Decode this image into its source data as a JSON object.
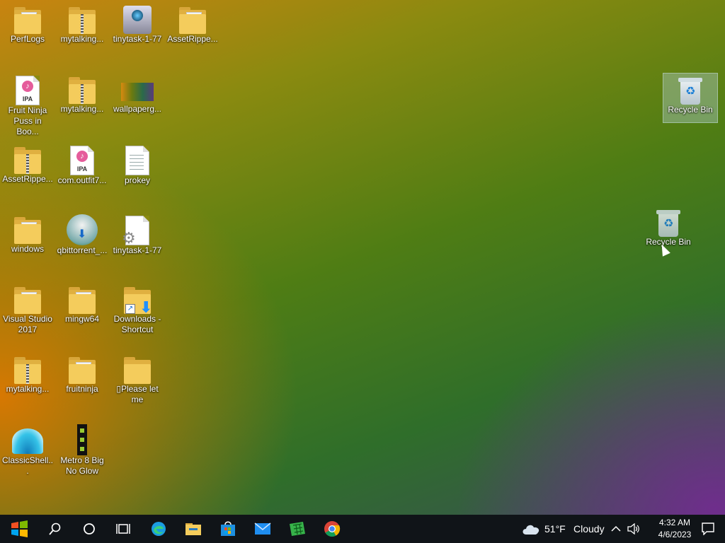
{
  "desktop": {
    "icons": [
      {
        "label": "PerfLogs",
        "type": "folder"
      },
      {
        "label": "mytalking...",
        "type": "zip-folder"
      },
      {
        "label": "tinytask-1-77",
        "type": "exe"
      },
      {
        "label": "AssetRippe...",
        "type": "folder"
      },
      {
        "label": "Fruit Ninja Puss in Boo...",
        "type": "ipa"
      },
      {
        "label": "mytalking...",
        "type": "zip-folder"
      },
      {
        "label": "wallpaperg...",
        "type": "image"
      },
      {
        "label": "AssetRippe...",
        "type": "zip-folder"
      },
      {
        "label": "com.outfit7...",
        "type": "ipa"
      },
      {
        "label": "prokey",
        "type": "text-file"
      },
      {
        "label": "windows",
        "type": "folder"
      },
      {
        "label": "qbittorrent_...",
        "type": "installer"
      },
      {
        "label": "tinytask-1-77",
        "type": "settings-file"
      },
      {
        "label": "Visual Studio 2017",
        "type": "folder"
      },
      {
        "label": "mingw64",
        "type": "folder"
      },
      {
        "label": "Downloads - Shortcut",
        "type": "shortcut"
      },
      {
        "label": "mytalking...",
        "type": "zip-folder"
      },
      {
        "label": "fruitninja",
        "type": "folder"
      },
      {
        "label": "▯Please let me",
        "type": "folder"
      },
      {
        "label": "ClassicShell...",
        "type": "shell"
      },
      {
        "label": "Metro 8 Big No Glow",
        "type": "metro"
      },
      {
        "label": "Recycle Bin",
        "type": "recycle-bin"
      },
      {
        "label": "Recycle Bin",
        "type": "recycle-bin"
      }
    ]
  },
  "taskbar": {
    "start": "start-icon",
    "search": "search-icon",
    "cortana": "cortana-icon",
    "taskview": "task-view-icon",
    "weather": {
      "temp": "51°F",
      "condition": "Cloudy"
    },
    "clock": {
      "time": "4:32 AM",
      "date": "4/6/2023"
    }
  }
}
